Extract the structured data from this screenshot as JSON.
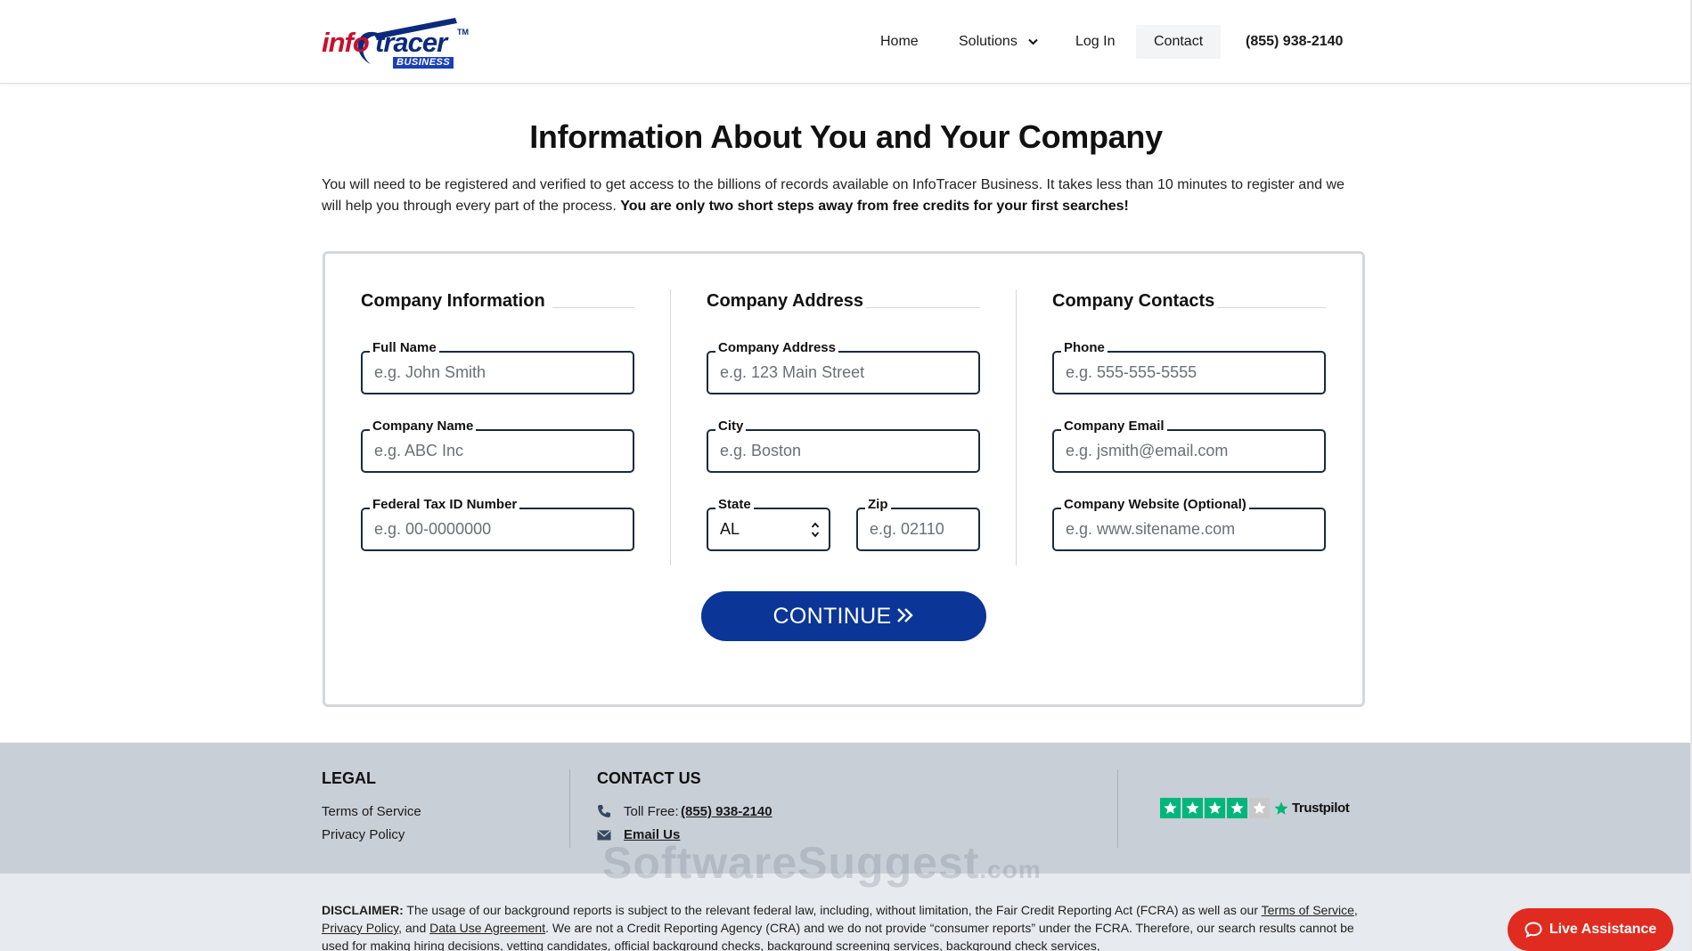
{
  "header": {
    "logo": {
      "info": "info",
      "tracer": "tracer",
      "tm": "TM",
      "business": "BUSINESS"
    },
    "nav": {
      "home": "Home",
      "solutions": "Solutions",
      "login": "Log In",
      "contact": "Contact",
      "phone": "(855) 938-2140"
    }
  },
  "main": {
    "title": "Information About You and Your Company",
    "intro_text": "You will need to be registered and verified to get access to the billions of records available on InfoTracer Business. It takes less than 10 minutes to register and we will help you through every part of the process.",
    "intro_bold": "You are only two short steps away from free credits for your first searches!",
    "columns": {
      "company_info": {
        "heading": "Company Information",
        "full_name": {
          "label": "Full Name",
          "placeholder": "e.g. John Smith"
        },
        "company_name": {
          "label": "Company Name",
          "placeholder": "e.g. ABC Inc"
        },
        "tax_id": {
          "label": "Federal Tax ID Number",
          "placeholder": "e.g. 00-0000000"
        }
      },
      "company_address": {
        "heading": "Company Address",
        "address": {
          "label": "Company Address",
          "placeholder": "e.g. 123 Main Street"
        },
        "city": {
          "label": "City",
          "placeholder": "e.g. Boston"
        },
        "state": {
          "label": "State",
          "value": "AL"
        },
        "zip": {
          "label": "Zip",
          "placeholder": "e.g. 02110"
        }
      },
      "company_contacts": {
        "heading": "Company Contacts",
        "phone": {
          "label": "Phone",
          "placeholder": "e.g. 555-555-5555"
        },
        "email": {
          "label": "Company Email",
          "placeholder": "e.g. jsmith@email.com"
        },
        "website": {
          "label": "Company Website (Optional)",
          "placeholder": "e.g. www.sitename.com"
        }
      }
    },
    "continue_label": "CONTINUE"
  },
  "footer": {
    "legal": {
      "heading": "LEGAL",
      "terms": "Terms of Service",
      "privacy": "Privacy Policy"
    },
    "contact": {
      "heading": "CONTACT US",
      "toll_free_label": "Toll Free:",
      "toll_free_number": "(855) 938-2140",
      "email_us": "Email Us"
    },
    "trustpilot": {
      "label": "Trustpilot",
      "stars": 4,
      "max_stars": 5
    }
  },
  "disclaimer": {
    "label": "DISCLAIMER:",
    "text1": "The usage of our background reports is subject to the relevant federal law, including, without limitation, the Fair Credit Reporting Act (FCRA) as well as our",
    "terms": "Terms of Service",
    "sep1": ",",
    "privacy": "Privacy Policy",
    "sep2": ", and",
    "dua": "Data Use Agreement",
    "text2": ". We are not a Credit Reporting Agency (CRA) and we do not provide “consumer reports” under the FCRA. Therefore, our search results cannot be used for making hiring decisions, vetting candidates, official background checks, background screening services, background check services,"
  },
  "watermark": {
    "main": "SoftwareSuggest",
    "suffix": ".com"
  },
  "live_assistance": "Live Assistance",
  "colors": {
    "brand_blue": "#0b3597",
    "brand_red": "#c8102e",
    "live_red": "#e02b20",
    "trustpilot_green": "#00b67a"
  }
}
